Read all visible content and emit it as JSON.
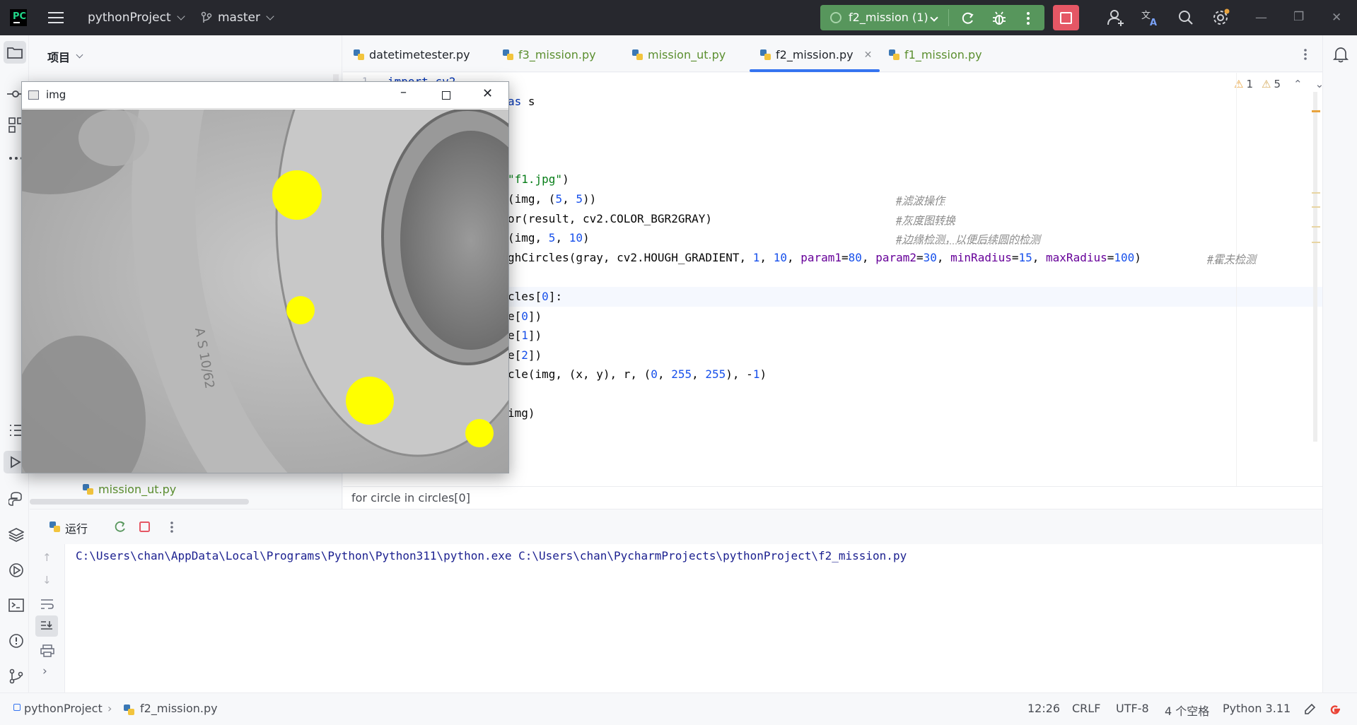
{
  "titlebar": {
    "project": "pythonProject",
    "branch": "master",
    "run_config": "f2_mission (1)"
  },
  "project_panel": {
    "title": "项目",
    "visible_file": "mission_ut.py"
  },
  "editor": {
    "tabs": [
      {
        "label": "datetimetester.py"
      },
      {
        "label": "f3_mission.py"
      },
      {
        "label": "mission_ut.py"
      },
      {
        "label": "f2_mission.py"
      },
      {
        "label": "f1_mission.py"
      }
    ],
    "warnings": "1",
    "weak_warnings": "5",
    "visible_line_number": "1",
    "comments": [
      "#滤波操作",
      "#灰度图转换",
      "#边缘检测，以便后续圆的检测",
      "#霍夫检测"
    ],
    "breadcrumb": "for circle in circles[0]"
  },
  "image_window": {
    "title": "img"
  },
  "run_panel": {
    "title": "运行",
    "console_line": "C:\\Users\\chan\\AppData\\Local\\Programs\\Python\\Python311\\python.exe C:\\Users\\chan\\PycharmProjects\\pythonProject\\f2_mission.py"
  },
  "statusbar": {
    "project": "pythonProject",
    "file": "f2_mission.py",
    "position": "12:26",
    "line_sep": "CRLF",
    "encoding": "UTF-8",
    "indent": "4 个空格",
    "interpreter": "Python 3.11"
  },
  "colors": {
    "run_green": "#57965c",
    "stop_red": "#e55765",
    "accent_blue": "#3574f0",
    "circle_yellow": "#ffff00"
  }
}
